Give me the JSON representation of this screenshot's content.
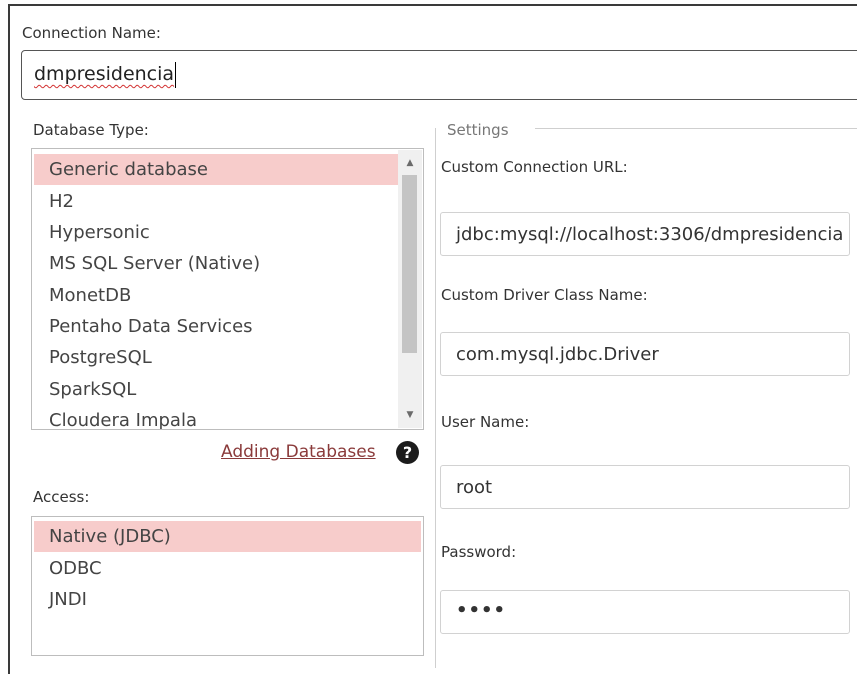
{
  "connection": {
    "label": "Connection Name:",
    "value": "dmpresidencia"
  },
  "database_type": {
    "label": "Database Type:",
    "items": [
      "Generic database",
      "H2",
      "Hypersonic",
      "MS SQL Server (Native)",
      "MonetDB",
      "Pentaho Data Services",
      "PostgreSQL",
      "SparkSQL",
      "Cloudera Impala"
    ],
    "selected": "Generic database",
    "scroll_up_icon": "triangle-up-icon",
    "scroll_down_icon": "triangle-down-icon"
  },
  "help": {
    "link_label": "Adding Databases",
    "icon": "?"
  },
  "access": {
    "label": "Access:",
    "items": [
      "Native (JDBC)",
      "ODBC",
      "JNDI"
    ],
    "selected": "Native (JDBC)"
  },
  "settings": {
    "legend": "Settings",
    "url_label": "Custom Connection URL:",
    "url_value": "jdbc:mysql://localhost:3306/dmpresidencia",
    "driver_label": "Custom Driver Class Name:",
    "driver_value": "com.mysql.jdbc.Driver",
    "user_label": "User Name:",
    "user_value": "root",
    "password_label": "Password:",
    "password_masked": "••••"
  },
  "colors": {
    "selection": "#f7cccb",
    "link": "#8a3a3a"
  }
}
